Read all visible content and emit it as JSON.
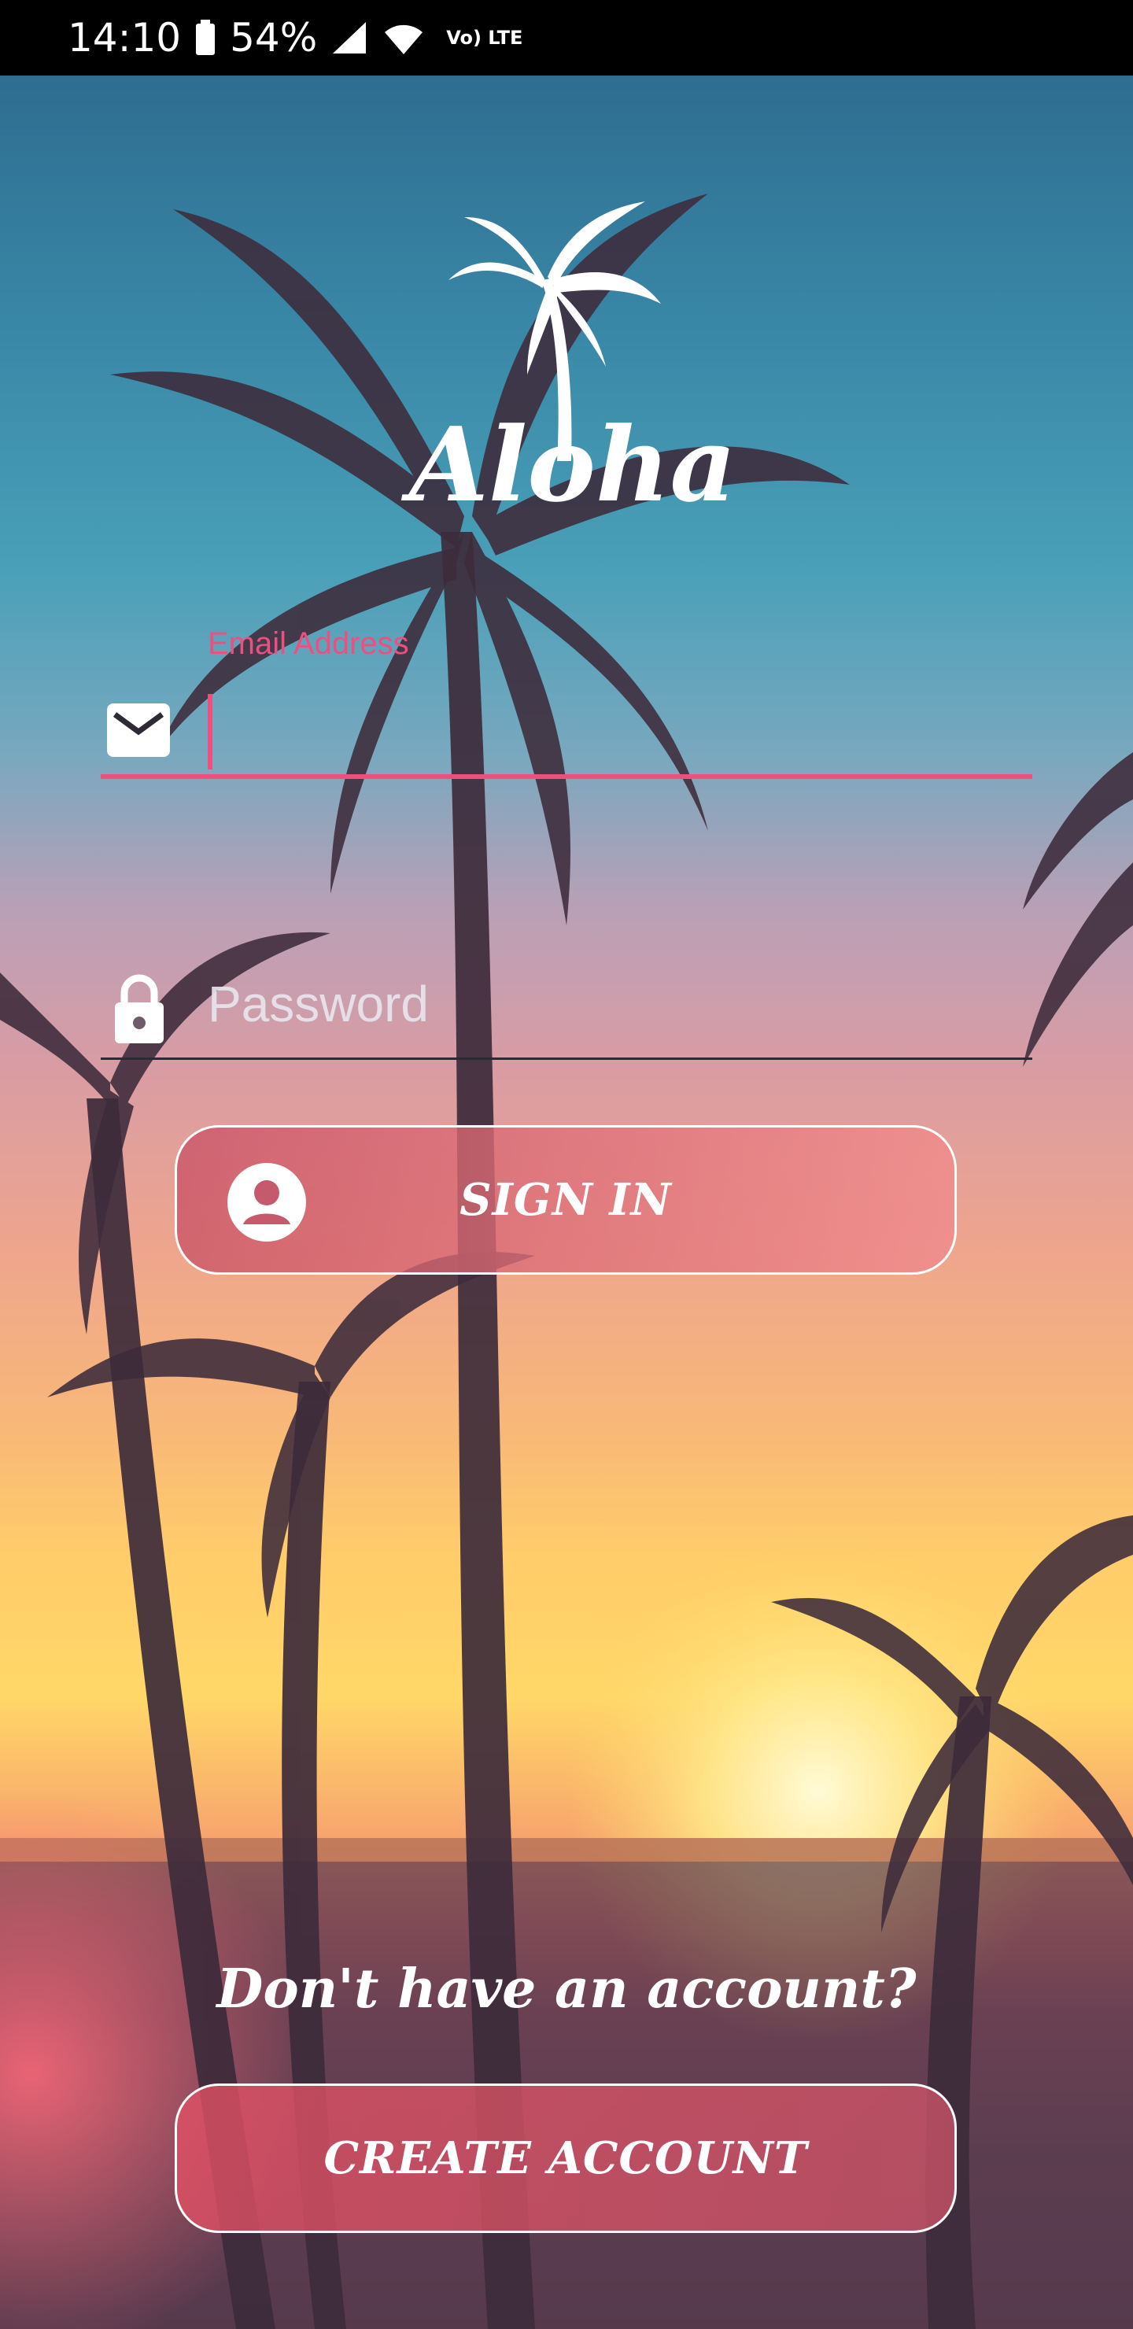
{
  "status_bar": {
    "time": "14:10",
    "battery_percent": "54%",
    "network": "Vo) LTE"
  },
  "app": {
    "brand": "Aloha"
  },
  "login_form": {
    "email_label": "Email Address",
    "email_value": "",
    "password_placeholder": "Password",
    "password_value": "",
    "signin_label": "SIGN IN"
  },
  "signup": {
    "prompt": "Don't have an account?",
    "create_label": "CREATE ACCOUNT"
  },
  "colors": {
    "accent": "#ef4f7f",
    "button_border": "#ffffff"
  },
  "icons": {
    "email": "envelope-icon",
    "password": "lock-icon",
    "signin": "account-circle-icon",
    "logo": "palm-tree-icon"
  }
}
